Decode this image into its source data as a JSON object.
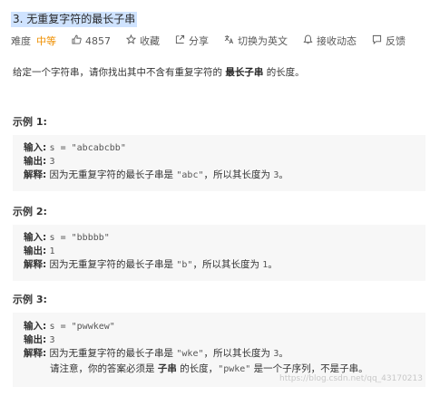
{
  "problem": {
    "title": "3. 无重复字符的最长子串"
  },
  "meta": {
    "difficulty_label": "难度",
    "difficulty_value": "中等",
    "likes": "4857",
    "favorite_label": "收藏",
    "share_label": "分享",
    "switch_lang_label": "切换为英文",
    "notify_label": "接收动态",
    "feedback_label": "反馈",
    "colors": {
      "difficulty": "#ef8f00"
    }
  },
  "description": {
    "prefix": "给定一个字符串，请你找出其中不含有重复字符的",
    "emphasis": "最长子串",
    "suffix": "的长度。"
  },
  "examples": [
    {
      "title": "示例 1:",
      "input_label": "输入:",
      "input_value": "s = \"abcabcbb\"",
      "output_label": "输出:",
      "output_value": "3",
      "explain_label": "解释:",
      "explain_prefix": "因为无重复字符的最长子串是",
      "explain_code": "\"abc\"",
      "explain_mid": "，所以其长度为",
      "explain_num": "3",
      "explain_end": "。"
    },
    {
      "title": "示例 2:",
      "input_label": "输入:",
      "input_value": "s = \"bbbbb\"",
      "output_label": "输出:",
      "output_value": "1",
      "explain_label": "解释:",
      "explain_prefix": "因为无重复字符的最长子串是",
      "explain_code": "\"b\"",
      "explain_mid": "，所以其长度为",
      "explain_num": "1",
      "explain_end": "。"
    },
    {
      "title": "示例 3:",
      "input_label": "输入:",
      "input_value": "s = \"pwwkew\"",
      "output_label": "输出:",
      "output_value": "3",
      "explain_label": "解释:",
      "explain_prefix": "因为无重复字符的最长子串是",
      "explain_code": "\"wke\"",
      "explain_mid": "，所以其长度为",
      "explain_num": "3",
      "explain_end": "。",
      "note_prefix": "请注意，你的答案必须是",
      "note_bold": "子串",
      "note_mid": "的长度，",
      "note_code": "\"pwke\"",
      "note_end": "是一个子序列，不是子串。"
    }
  ],
  "watermark": "https://blog.csdn.net/qq_43170213"
}
